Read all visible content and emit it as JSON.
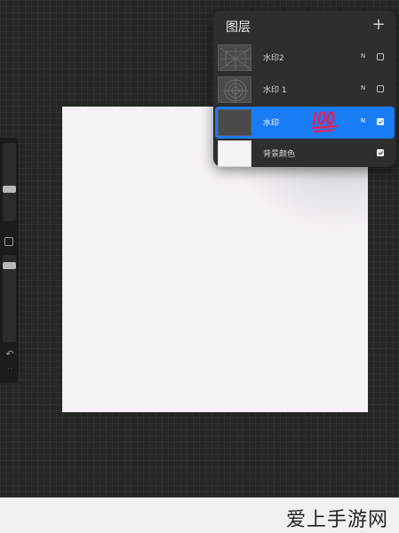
{
  "layers_panel": {
    "title": "图层",
    "add_icon": "+",
    "layers": [
      {
        "name": "水印2",
        "blend": "N",
        "visible": false,
        "selected": false,
        "thumbnail": "grid-pattern"
      },
      {
        "name": "水印 1",
        "blend": "N",
        "visible": false,
        "selected": false,
        "thumbnail": "circle-pattern"
      },
      {
        "name": "水印",
        "blend": "N",
        "visible": true,
        "selected": true,
        "thumbnail": "empty",
        "emoji": "hundred-points"
      },
      {
        "name": "背景颜色",
        "blend": "",
        "visible": true,
        "selected": false,
        "thumbnail": "swatch"
      }
    ]
  },
  "sidebar": {
    "undo_icon": "↶",
    "redo_icon": "··"
  },
  "colors": {
    "accent": "#1a7cf5",
    "canvas": "#f6f1f7",
    "workspace": "#262626",
    "panel": "#2e2e2e"
  },
  "watermark": "爱上手游网"
}
